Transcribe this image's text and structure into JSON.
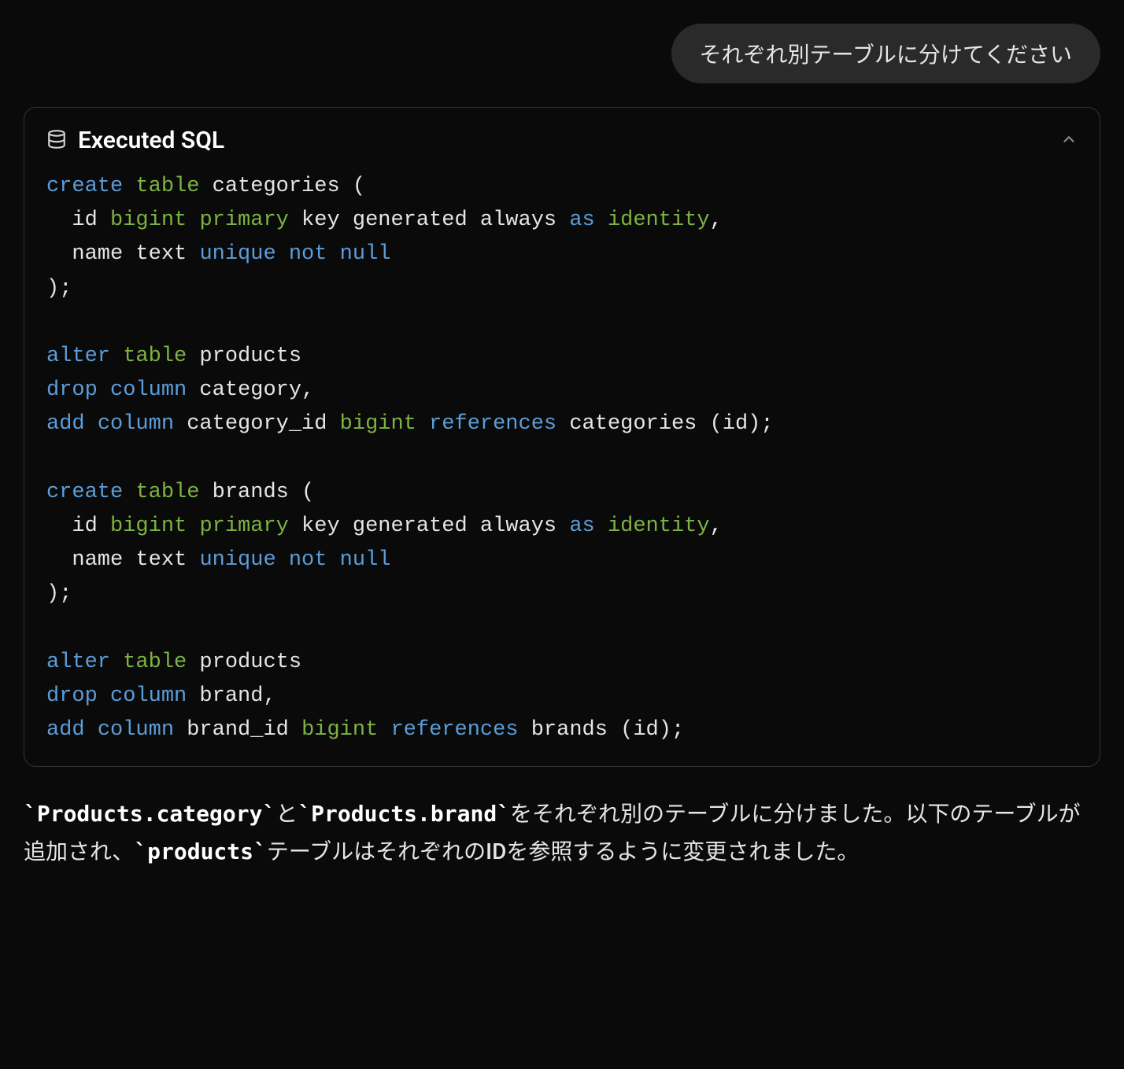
{
  "user_message": "それぞれ別テーブルに分けてください",
  "sql_card": {
    "title": "Executed SQL",
    "code_tokens": [
      [
        {
          "t": "create",
          "c": "blue"
        },
        {
          "t": " ",
          "c": "white"
        },
        {
          "t": "table",
          "c": "green"
        },
        {
          "t": " categories (",
          "c": "white"
        }
      ],
      [
        {
          "t": "  id ",
          "c": "white"
        },
        {
          "t": "bigint",
          "c": "green"
        },
        {
          "t": " ",
          "c": "white"
        },
        {
          "t": "primary",
          "c": "green"
        },
        {
          "t": " key generated always ",
          "c": "white"
        },
        {
          "t": "as",
          "c": "blue"
        },
        {
          "t": " ",
          "c": "white"
        },
        {
          "t": "identity",
          "c": "green"
        },
        {
          "t": ",",
          "c": "white"
        }
      ],
      [
        {
          "t": "  name text ",
          "c": "white"
        },
        {
          "t": "unique",
          "c": "blue"
        },
        {
          "t": " ",
          "c": "white"
        },
        {
          "t": "not",
          "c": "blue"
        },
        {
          "t": " ",
          "c": "white"
        },
        {
          "t": "null",
          "c": "blue"
        }
      ],
      [
        {
          "t": ");",
          "c": "white"
        }
      ],
      [
        {
          "t": "",
          "c": "white"
        }
      ],
      [
        {
          "t": "alter",
          "c": "blue"
        },
        {
          "t": " ",
          "c": "white"
        },
        {
          "t": "table",
          "c": "green"
        },
        {
          "t": " products",
          "c": "white"
        }
      ],
      [
        {
          "t": "drop",
          "c": "blue"
        },
        {
          "t": " ",
          "c": "white"
        },
        {
          "t": "column",
          "c": "blue"
        },
        {
          "t": " category,",
          "c": "white"
        }
      ],
      [
        {
          "t": "add",
          "c": "blue"
        },
        {
          "t": " ",
          "c": "white"
        },
        {
          "t": "column",
          "c": "blue"
        },
        {
          "t": " category_id ",
          "c": "white"
        },
        {
          "t": "bigint",
          "c": "green"
        },
        {
          "t": " ",
          "c": "white"
        },
        {
          "t": "references",
          "c": "blue"
        },
        {
          "t": " categories (id);",
          "c": "white"
        }
      ],
      [
        {
          "t": "",
          "c": "white"
        }
      ],
      [
        {
          "t": "create",
          "c": "blue"
        },
        {
          "t": " ",
          "c": "white"
        },
        {
          "t": "table",
          "c": "green"
        },
        {
          "t": " brands (",
          "c": "white"
        }
      ],
      [
        {
          "t": "  id ",
          "c": "white"
        },
        {
          "t": "bigint",
          "c": "green"
        },
        {
          "t": " ",
          "c": "white"
        },
        {
          "t": "primary",
          "c": "green"
        },
        {
          "t": " key generated always ",
          "c": "white"
        },
        {
          "t": "as",
          "c": "blue"
        },
        {
          "t": " ",
          "c": "white"
        },
        {
          "t": "identity",
          "c": "green"
        },
        {
          "t": ",",
          "c": "white"
        }
      ],
      [
        {
          "t": "  name text ",
          "c": "white"
        },
        {
          "t": "unique",
          "c": "blue"
        },
        {
          "t": " ",
          "c": "white"
        },
        {
          "t": "not",
          "c": "blue"
        },
        {
          "t": " ",
          "c": "white"
        },
        {
          "t": "null",
          "c": "blue"
        }
      ],
      [
        {
          "t": ");",
          "c": "white"
        }
      ],
      [
        {
          "t": "",
          "c": "white"
        }
      ],
      [
        {
          "t": "alter",
          "c": "blue"
        },
        {
          "t": " ",
          "c": "white"
        },
        {
          "t": "table",
          "c": "green"
        },
        {
          "t": " products",
          "c": "white"
        }
      ],
      [
        {
          "t": "drop",
          "c": "blue"
        },
        {
          "t": " ",
          "c": "white"
        },
        {
          "t": "column",
          "c": "blue"
        },
        {
          "t": " brand,",
          "c": "white"
        }
      ],
      [
        {
          "t": "add",
          "c": "blue"
        },
        {
          "t": " ",
          "c": "white"
        },
        {
          "t": "column",
          "c": "blue"
        },
        {
          "t": " brand_id ",
          "c": "white"
        },
        {
          "t": "bigint",
          "c": "green"
        },
        {
          "t": " ",
          "c": "white"
        },
        {
          "t": "references",
          "c": "blue"
        },
        {
          "t": " brands (id);",
          "c": "white"
        }
      ]
    ]
  },
  "explanation": {
    "parts": [
      {
        "type": "code",
        "text": "`Products.category`"
      },
      {
        "type": "text",
        "text": "と"
      },
      {
        "type": "code",
        "text": "`Products.brand`"
      },
      {
        "type": "text",
        "text": "をそれぞれ別のテーブルに分けました。以下のテーブルが追加され、"
      },
      {
        "type": "code",
        "text": "`products`"
      },
      {
        "type": "text",
        "text": "テーブルはそれぞれのIDを参照するように変更されました。"
      }
    ]
  }
}
